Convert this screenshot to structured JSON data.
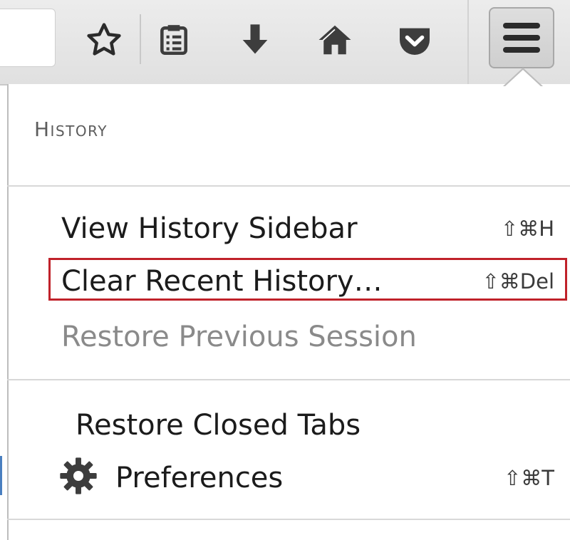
{
  "toolbar": {
    "icons": [
      "star-icon",
      "reading-list-icon",
      "download-icon",
      "home-icon",
      "pocket-icon",
      "hamburger-menu-icon"
    ]
  },
  "panel": {
    "title": "History",
    "items": [
      {
        "label": "View History Sidebar",
        "shortcut": "⇧⌘H",
        "enabled": true
      },
      {
        "label": "Clear Recent History…",
        "shortcut": "⇧⌘Del",
        "enabled": true,
        "highlighted": true
      },
      {
        "label": "Restore Previous Session",
        "shortcut": "",
        "enabled": false
      },
      {
        "label": "Restore Closed Tabs",
        "shortcut": "",
        "enabled": true
      },
      {
        "label": "Preferences",
        "shortcut": "⇧⌘T",
        "enabled": true,
        "icon": "gear-icon"
      }
    ]
  },
  "colors": {
    "highlight": "#c0222a",
    "disabled_text": "#8a8a8a",
    "icon_gray": "#3d3d3d"
  }
}
